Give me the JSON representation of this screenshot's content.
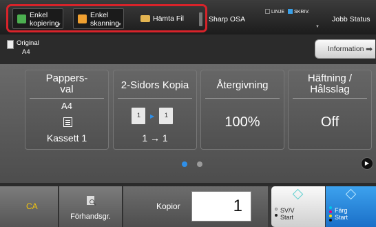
{
  "toolbar": {
    "shortcuts": [
      {
        "label": "Enkel\nkopiering",
        "icon": "copy-icon"
      },
      {
        "label": "Enkel\nskanning",
        "icon": "scan-icon"
      },
      {
        "label": "Hämta Fil",
        "icon": "folder-icon"
      }
    ],
    "sharp_osa": "Sharp OSA",
    "status_line": "LINJE",
    "status_write": "SKRIV.",
    "job_status": "Jobb Status"
  },
  "original": {
    "label": "Original",
    "size": "A4"
  },
  "information": "Information",
  "tiles": [
    {
      "title": "Pappers-\nval",
      "value": "A4",
      "sub": "Kassett 1"
    },
    {
      "title": "2-Sidors Kopia",
      "value": "1 → 1"
    },
    {
      "title": "Återgivning",
      "value": "100%"
    },
    {
      "title": "Häftning /\nHålsslag",
      "value": "Off"
    }
  ],
  "pager": {
    "current": 1,
    "total": 2
  },
  "bottom": {
    "ca": "CA",
    "preview": "Förhandsgr.",
    "copies_label": "Kopior",
    "copies_value": "1",
    "bw_start": "SV/V",
    "bw_start_sub": "Start",
    "color_start": "Färg",
    "color_start_sub": "Start"
  },
  "colors": {
    "highlight": "#d8232a",
    "ca_text": "#f2c40e",
    "color_start": "#2b8ae0",
    "dot_active": "#2f8fe8",
    "dot_inactive": "#9b9b9b"
  }
}
